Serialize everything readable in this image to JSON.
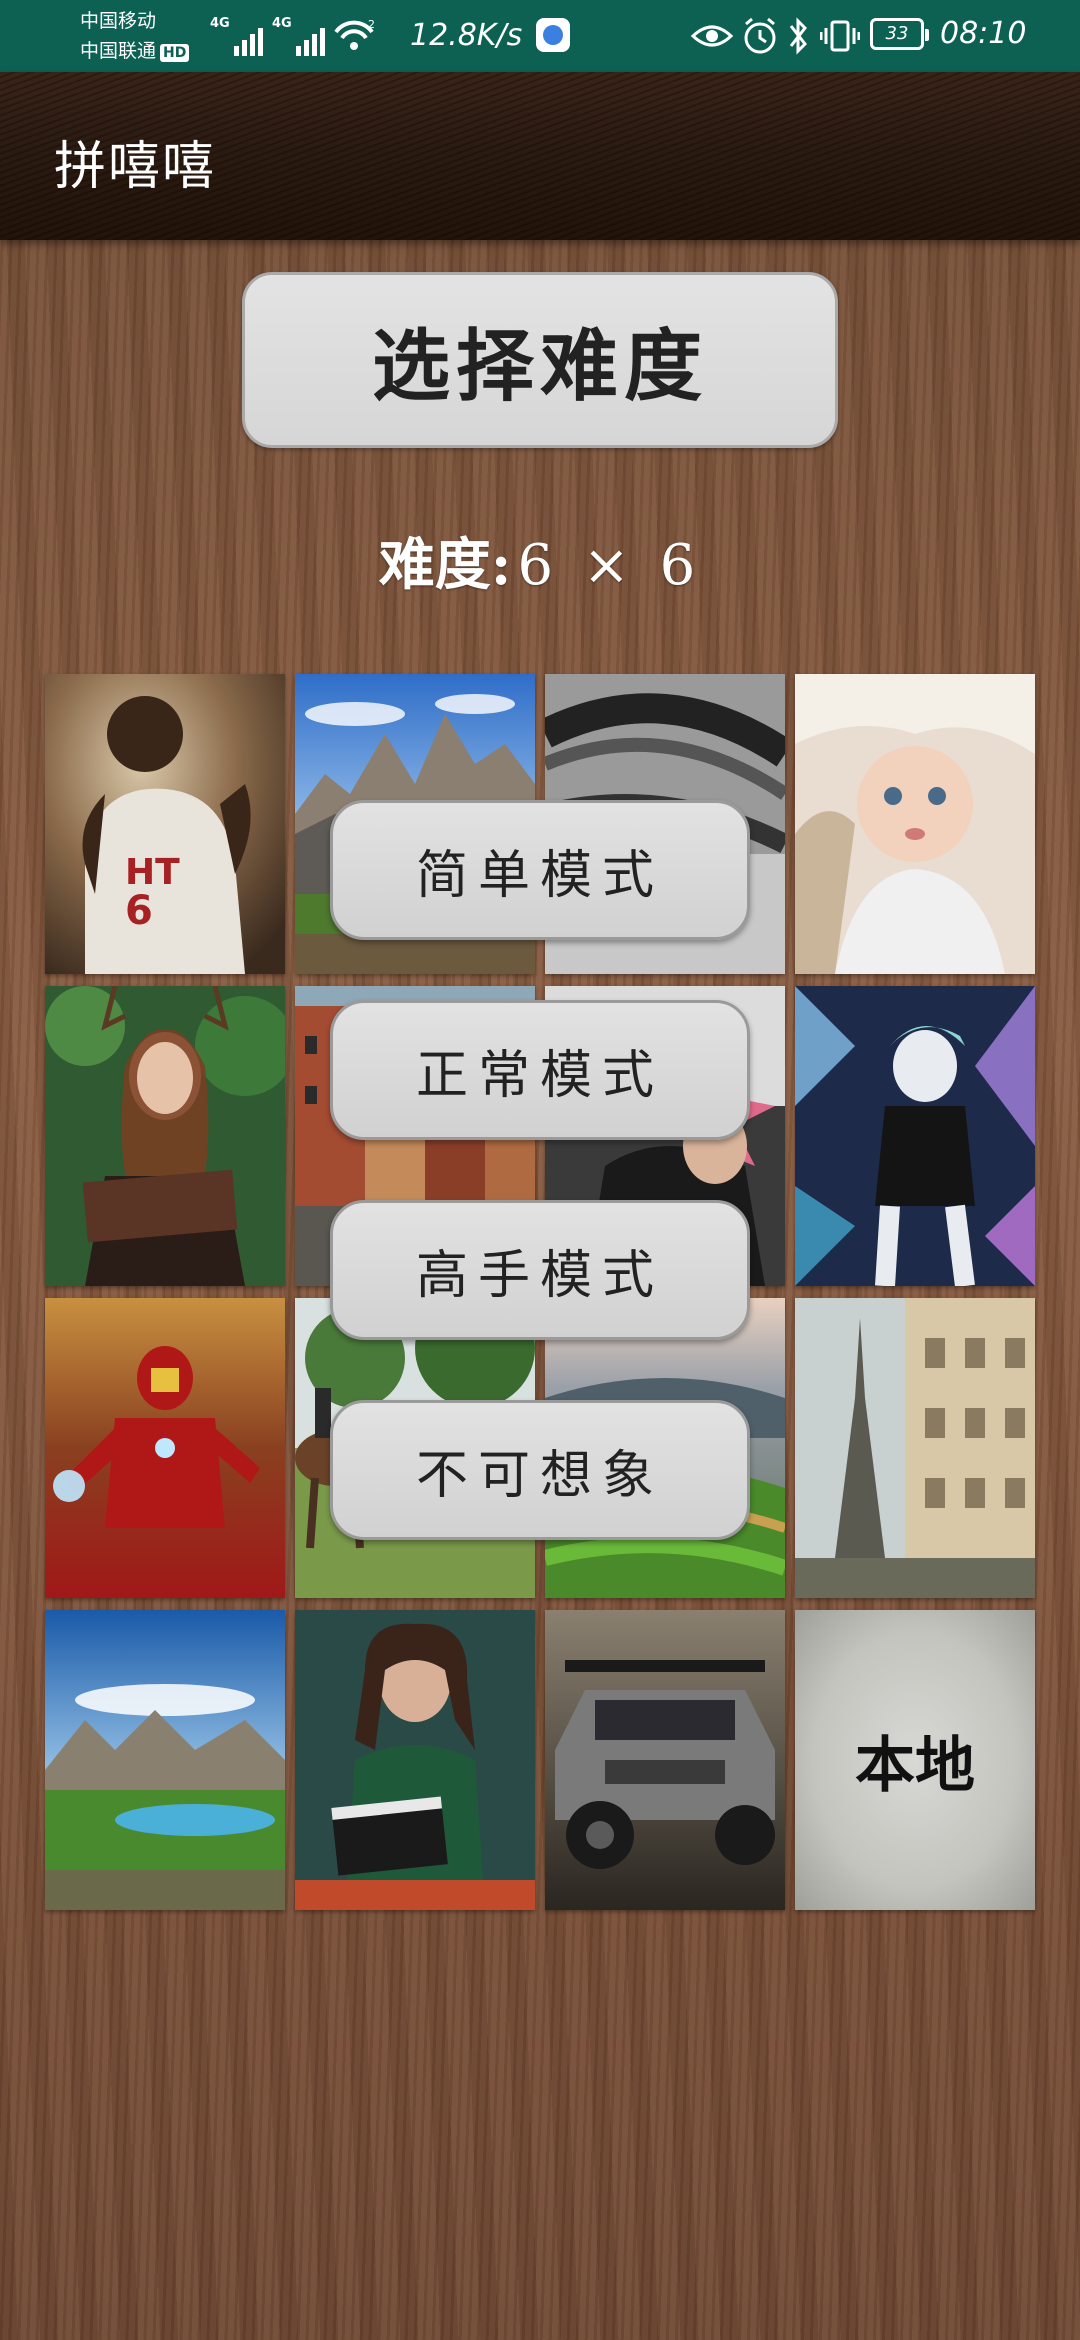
{
  "status_bar": {
    "carrier_1": "中国移动",
    "carrier_2": "中国联通",
    "hd": "HD",
    "net_1": "4G",
    "net_2": "4G",
    "hotspot_count": "2",
    "speed": "12.8K/s",
    "battery": "33",
    "time": "08:10"
  },
  "app_bar": {
    "title": "拼嘻嘻"
  },
  "main": {
    "select_button": "选择难度",
    "difficulty_label": "难度:",
    "difficulty_value": "6 × 6"
  },
  "grid": {
    "local_tile_label": "本地",
    "images": [
      "basketball-player-image",
      "mountain-peaks-image",
      "eye-closeup-image",
      "baby-image",
      "woman-with-book-image",
      "old-town-street-image",
      "anime-character-image",
      "crystal-anime-girl-image",
      "iron-man-image",
      "horse-rider-image",
      "rice-terrace-image",
      "eiffel-tower-image",
      "mountain-lake-image",
      "woman-clapperboard-image",
      "offroad-truck-image"
    ]
  },
  "modes": [
    {
      "label": "简单模式"
    },
    {
      "label": "正常模式"
    },
    {
      "label": "高手模式"
    },
    {
      "label": "不可想象"
    }
  ]
}
